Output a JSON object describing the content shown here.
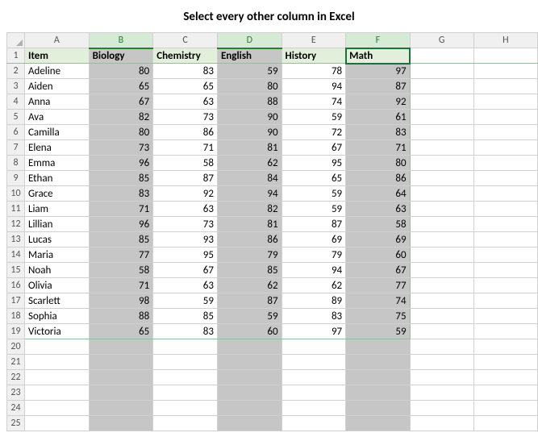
{
  "title": "Select every other column in Excel",
  "col_letters": [
    "A",
    "B",
    "C",
    "D",
    "E",
    "F",
    "G",
    "H"
  ],
  "selected_cols": [
    "B",
    "D",
    "F"
  ],
  "active_col": "F",
  "header_row": {
    "Item": "Item",
    "Biology": "Biology",
    "Chemistry": "Chemistry",
    "English": "English",
    "History": "History",
    "Math": "Math"
  },
  "row_numbers": [
    1,
    2,
    3,
    4,
    5,
    6,
    7,
    8,
    9,
    10,
    11,
    12,
    13,
    14,
    15,
    16,
    17,
    18,
    19,
    20,
    21,
    22,
    23,
    24,
    25
  ],
  "chart_data": {
    "type": "table",
    "columns": [
      "Item",
      "Biology",
      "Chemistry",
      "English",
      "History",
      "Math"
    ],
    "rows": [
      {
        "Item": "Adeline",
        "Biology": 80,
        "Chemistry": 83,
        "English": 59,
        "History": 78,
        "Math": 97
      },
      {
        "Item": "Aiden",
        "Biology": 65,
        "Chemistry": 65,
        "English": 80,
        "History": 94,
        "Math": 87
      },
      {
        "Item": "Anna",
        "Biology": 67,
        "Chemistry": 63,
        "English": 88,
        "History": 74,
        "Math": 92
      },
      {
        "Item": "Ava",
        "Biology": 82,
        "Chemistry": 73,
        "English": 90,
        "History": 59,
        "Math": 61
      },
      {
        "Item": "Camilla",
        "Biology": 80,
        "Chemistry": 86,
        "English": 90,
        "History": 72,
        "Math": 83
      },
      {
        "Item": "Elena",
        "Biology": 73,
        "Chemistry": 71,
        "English": 81,
        "History": 67,
        "Math": 71
      },
      {
        "Item": "Emma",
        "Biology": 96,
        "Chemistry": 58,
        "English": 62,
        "History": 95,
        "Math": 80
      },
      {
        "Item": "Ethan",
        "Biology": 85,
        "Chemistry": 87,
        "English": 84,
        "History": 65,
        "Math": 86
      },
      {
        "Item": "Grace",
        "Biology": 83,
        "Chemistry": 92,
        "English": 94,
        "History": 59,
        "Math": 64
      },
      {
        "Item": "Liam",
        "Biology": 71,
        "Chemistry": 63,
        "English": 82,
        "History": 59,
        "Math": 63
      },
      {
        "Item": "Lillian",
        "Biology": 96,
        "Chemistry": 73,
        "English": 81,
        "History": 87,
        "Math": 58
      },
      {
        "Item": "Lucas",
        "Biology": 85,
        "Chemistry": 93,
        "English": 86,
        "History": 69,
        "Math": 69
      },
      {
        "Item": "Maria",
        "Biology": 77,
        "Chemistry": 95,
        "English": 79,
        "History": 79,
        "Math": 60
      },
      {
        "Item": "Noah",
        "Biology": 58,
        "Chemistry": 67,
        "English": 85,
        "History": 94,
        "Math": 67
      },
      {
        "Item": "Olivia",
        "Biology": 71,
        "Chemistry": 63,
        "English": 62,
        "History": 62,
        "Math": 77
      },
      {
        "Item": "Scarlett",
        "Biology": 98,
        "Chemistry": 59,
        "English": 87,
        "History": 89,
        "Math": 74
      },
      {
        "Item": "Sophia",
        "Biology": 88,
        "Chemistry": 85,
        "English": 59,
        "History": 83,
        "Math": 75
      },
      {
        "Item": "Victoria",
        "Biology": 65,
        "Chemistry": 83,
        "English": 60,
        "History": 97,
        "Math": 59
      }
    ]
  }
}
